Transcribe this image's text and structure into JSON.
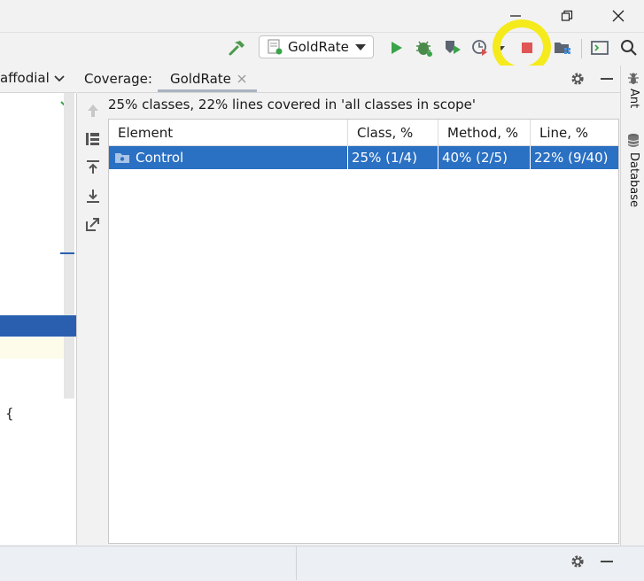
{
  "titlebar": {
    "minimize_icon": "minimize-icon",
    "restore_icon": "restore-icon",
    "close_icon": "close-icon"
  },
  "toolbar": {
    "run_config_label": "GoldRate",
    "icons": [
      "hammer-icon",
      "run-icon",
      "debug-icon",
      "coverage-icon",
      "profile-icon",
      "stop-icon",
      "project-structure-icon",
      "terminal-icon",
      "search-icon"
    ],
    "stop_color": "#e05555",
    "run_color": "#3aa44a"
  },
  "editor": {
    "tab_fragment": "affodials",
    "code_fragment": "{"
  },
  "coverage": {
    "label": "Coverage:",
    "tab": "GoldRate",
    "summary": "25% classes, 22% lines covered in 'all classes in scope'",
    "columns": [
      "Element",
      "Class, %",
      "Method, %",
      "Line, %"
    ],
    "rows": [
      {
        "element": "Control",
        "class": "25% (1/4)",
        "method": "40% (2/5)",
        "line": "22% (9/40)"
      }
    ],
    "selected_color": "#2a70c3"
  },
  "right_stripe": {
    "items": [
      "Ant",
      "Database"
    ]
  },
  "annotation": {
    "color": "#f5ea1c"
  }
}
